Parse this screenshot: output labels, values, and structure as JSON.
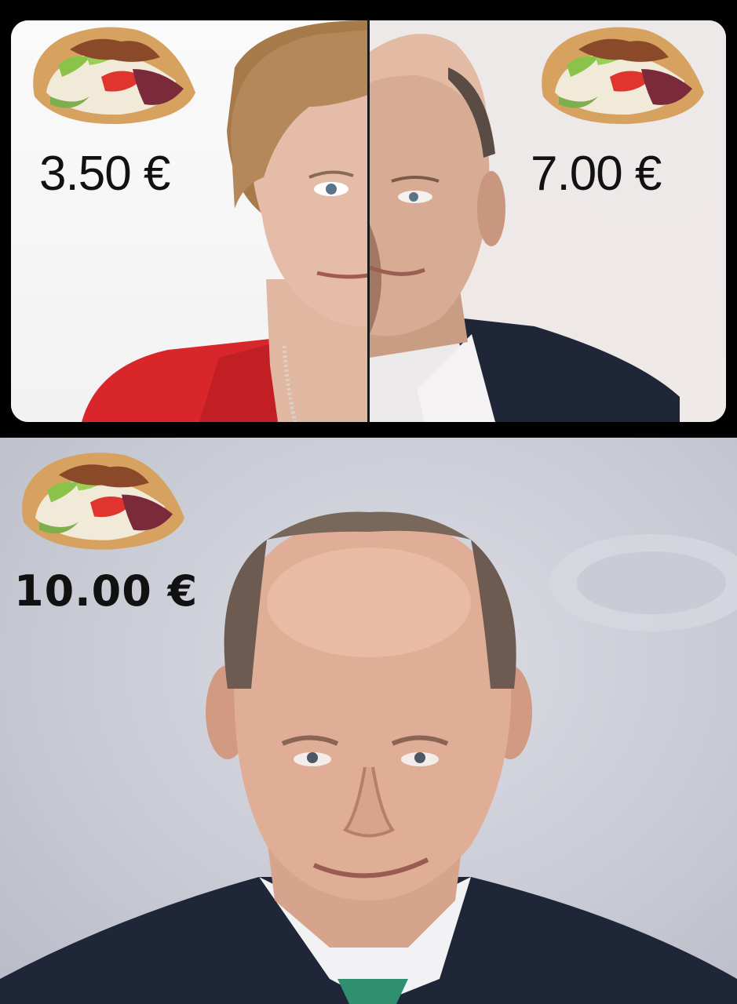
{
  "top_panel": {
    "left_price": "3.50 €",
    "right_price": "7.00 €"
  },
  "bottom_panel": {
    "price": "10.00 €"
  },
  "colors": {
    "background": "#000000",
    "jacket_red": "#d8262b",
    "jacket_navy": "#1e2638",
    "skin": "#e2b9a4",
    "bottom_bg": "#c9cbd5"
  }
}
